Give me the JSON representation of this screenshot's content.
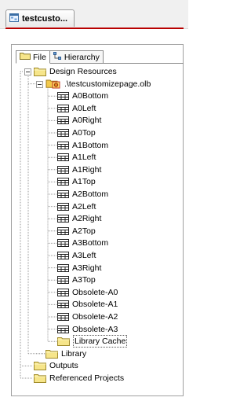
{
  "document_tab": {
    "label": "testcusto...",
    "icon": "schematic-doc-icon"
  },
  "view_tabs": [
    {
      "label": "File",
      "icon": "folder-icon",
      "active": true
    },
    {
      "label": "Hierarchy",
      "icon": "hierarchy-icon",
      "active": false
    }
  ],
  "tree": {
    "design_resources": "Design Resources",
    "library_file": ".\\testcustomizepage.olb",
    "parts": [
      "A0Bottom",
      "A0Left",
      "A0Right",
      "A0Top",
      "A1Bottom",
      "A1Left",
      "A1Right",
      "A1Top",
      "A2Bottom",
      "A2Left",
      "A2Right",
      "A2Top",
      "A3Bottom",
      "A3Left",
      "A3Right",
      "A3Top",
      "Obsolete-A0",
      "Obsolete-A1",
      "Obsolete-A2",
      "Obsolete-A3"
    ],
    "library_cache": "Library Cache",
    "library": "Library",
    "outputs": "Outputs",
    "referenced_projects": "Referenced Projects"
  },
  "colors": {
    "folder": "#f6e58a",
    "folder_border": "#b49a2a",
    "accent_line": "#b80000"
  }
}
